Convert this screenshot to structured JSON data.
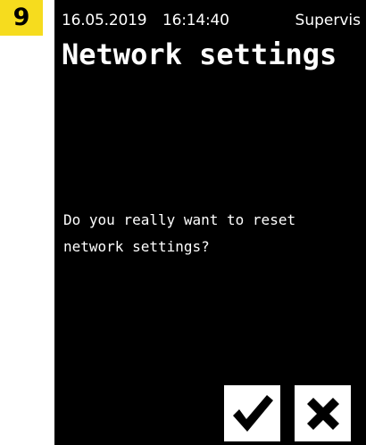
{
  "step": {
    "number": "9",
    "color": "#f6dc1e"
  },
  "status_bar": {
    "date": "16.05.2019",
    "time": "16:14:40",
    "user": "Supervis"
  },
  "screen": {
    "title": "Network settings",
    "message_line1": "Do you really want to reset",
    "message_line2": "network settings?",
    "background": "#000000",
    "foreground": "#ffffff"
  },
  "buttons": {
    "confirm_icon": "checkmark-icon",
    "cancel_icon": "close-icon"
  }
}
